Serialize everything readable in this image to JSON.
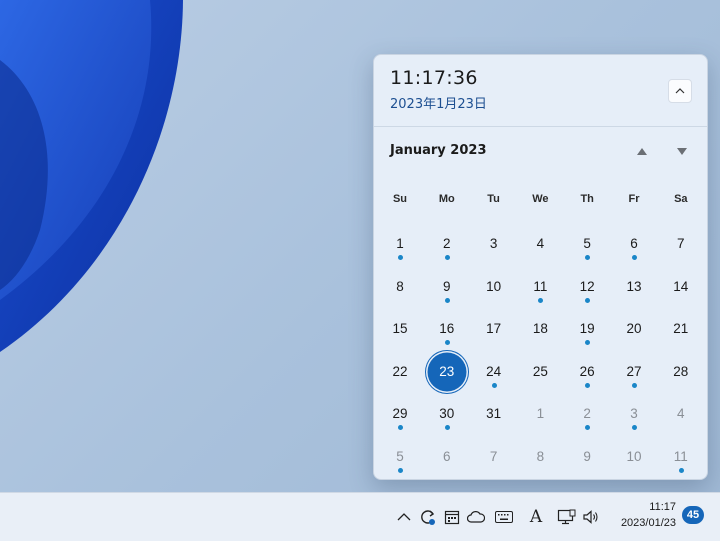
{
  "flyout": {
    "time": "11:17:36",
    "date": "2023年1月23日",
    "month_label": "January 2023",
    "weekdays": [
      "Su",
      "Mo",
      "Tu",
      "We",
      "Th",
      "Fr",
      "Sa"
    ],
    "days": [
      {
        "n": "1",
        "event": true
      },
      {
        "n": "2",
        "event": true
      },
      {
        "n": "3"
      },
      {
        "n": "4"
      },
      {
        "n": "5",
        "event": true
      },
      {
        "n": "6",
        "event": true
      },
      {
        "n": "7"
      },
      {
        "n": "8"
      },
      {
        "n": "9",
        "event": true
      },
      {
        "n": "10"
      },
      {
        "n": "11",
        "event": true
      },
      {
        "n": "12",
        "event": true
      },
      {
        "n": "13"
      },
      {
        "n": "14"
      },
      {
        "n": "15"
      },
      {
        "n": "16",
        "event": true
      },
      {
        "n": "17"
      },
      {
        "n": "18"
      },
      {
        "n": "19",
        "event": true
      },
      {
        "n": "20"
      },
      {
        "n": "21"
      },
      {
        "n": "22"
      },
      {
        "n": "23",
        "today": true
      },
      {
        "n": "24",
        "event": true
      },
      {
        "n": "25"
      },
      {
        "n": "26",
        "event": true
      },
      {
        "n": "27",
        "event": true
      },
      {
        "n": "28"
      },
      {
        "n": "29",
        "event": true
      },
      {
        "n": "30",
        "event": true
      },
      {
        "n": "31"
      },
      {
        "n": "1",
        "other": true
      },
      {
        "n": "2",
        "other": true,
        "event": true
      },
      {
        "n": "3",
        "other": true,
        "event": true
      },
      {
        "n": "4",
        "other": true
      },
      {
        "n": "5",
        "other": true,
        "event": true
      },
      {
        "n": "6",
        "other": true
      },
      {
        "n": "7",
        "other": true
      },
      {
        "n": "8",
        "other": true
      },
      {
        "n": "9",
        "other": true
      },
      {
        "n": "10",
        "other": true
      },
      {
        "n": "11",
        "other": true,
        "event": true
      }
    ]
  },
  "taskbar": {
    "tray_icons": [
      "chevron-up-icon",
      "sync-icon",
      "calendar-app-icon",
      "cloud-icon",
      "keyboard-icon",
      "ime-a-icon",
      "network-icon",
      "speaker-icon"
    ],
    "time": "11:17",
    "date": "2023/01/23",
    "notification_count": "45"
  },
  "colors": {
    "accent": "#1566b9",
    "event_dot": "#1a86c8",
    "flyout_bg": "#e6eef8"
  }
}
